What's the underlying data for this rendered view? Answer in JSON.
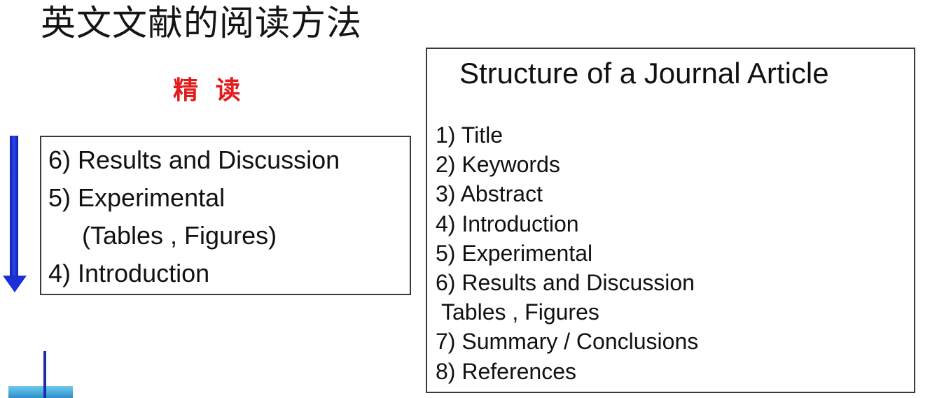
{
  "slide": {
    "title": "英文文献的阅读方法",
    "intensive_label": "精 读"
  },
  "reading_order": {
    "items": [
      "6) Results and Discussion",
      "5) Experimental",
      "(Tables , Figures)",
      "4) Introduction"
    ]
  },
  "structure": {
    "title": "Structure of a Journal Article",
    "items": [
      "1) Title",
      "2) Keywords",
      "3) Abstract",
      "4) Introduction",
      "5) Experimental",
      "6) Results and Discussion",
      "Tables , Figures",
      "7) Summary / Conclusions",
      "8) References"
    ]
  },
  "icons": {
    "down_arrow": "down-arrow-icon",
    "bottom_marker": "pin-icon"
  },
  "colors": {
    "intensive_label": "#e21b1b",
    "arrow": "#1c2fd6",
    "marker": "#3aa7dc"
  }
}
